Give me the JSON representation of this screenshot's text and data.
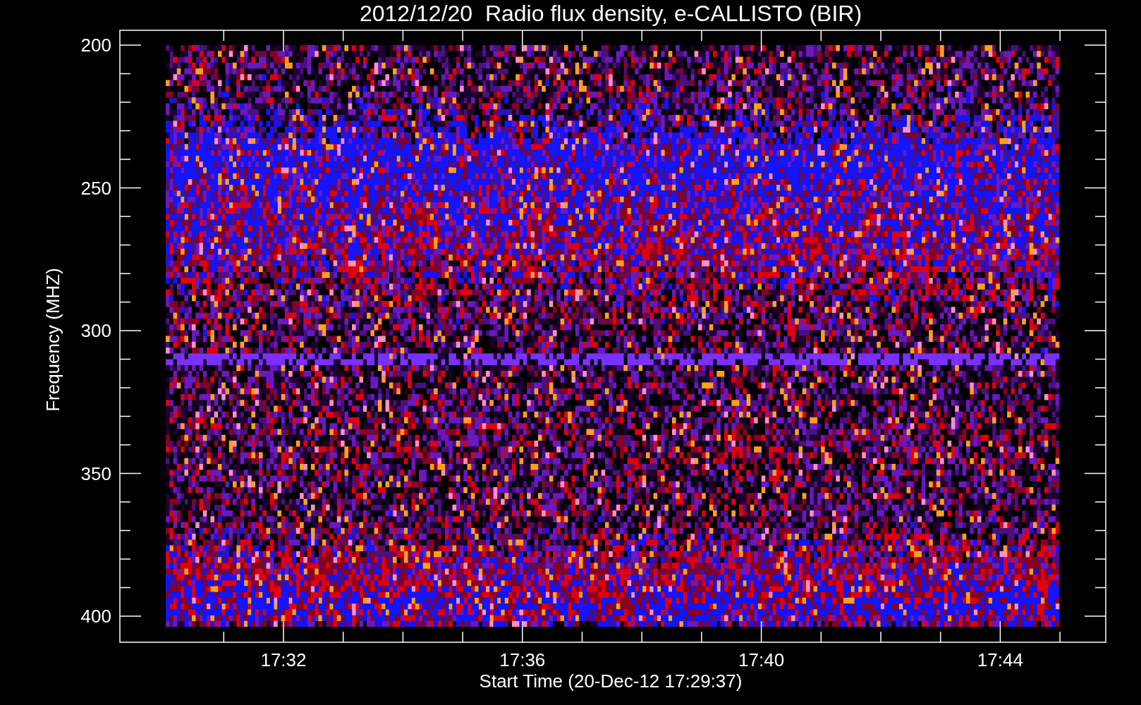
{
  "title": "2012/12/20  Radio flux density, e-CALLISTO (BIR)",
  "ylabel": "Frequency (MHZ)",
  "yticks": [
    "200",
    "250",
    "300",
    "350",
    "400"
  ],
  "xticks": [
    "17:32",
    "17:36",
    "17:40",
    "17:44"
  ],
  "xlabel": "Start Time (20-Dec-12 17:29:37)"
}
